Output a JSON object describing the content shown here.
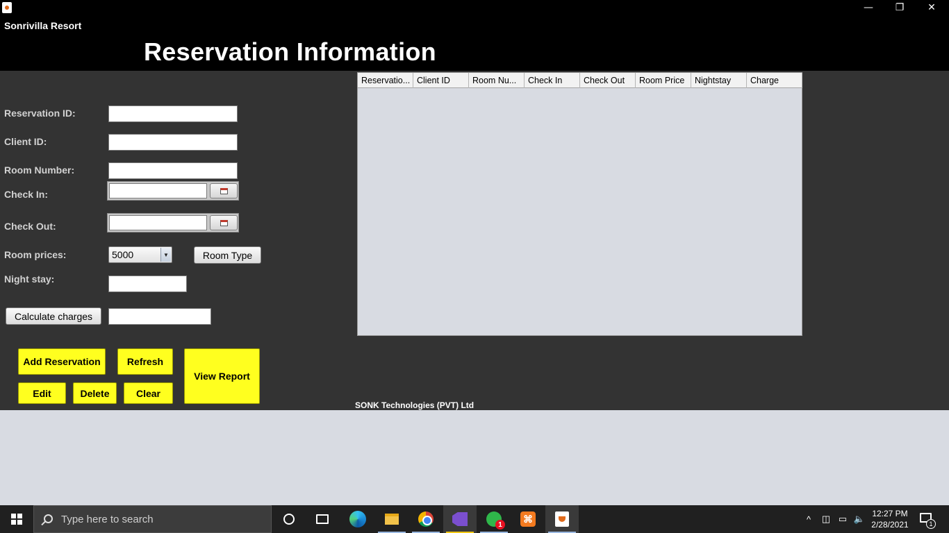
{
  "window": {
    "app_name": "Sonrivilla Resort",
    "title": "Reservation Information",
    "minimize_glyph": "—",
    "maximize_glyph": "❐",
    "close_glyph": "✕"
  },
  "form": {
    "reservation_id_label": "Reservation ID:",
    "client_id_label": "Client ID:",
    "room_number_label": "Room Number:",
    "check_in_label": "Check In:",
    "check_out_label": "Check Out:",
    "room_prices_label": "Room prices:",
    "night_stay_label": "Night stay:",
    "room_price_selected": "5000",
    "reservation_id_value": "",
    "client_id_value": "",
    "room_number_value": "",
    "check_in_value": "",
    "check_out_value": "",
    "night_stay_value": "",
    "charge_value": ""
  },
  "buttons": {
    "room_type": "Room Type",
    "calculate_charges": "Calculate charges",
    "add_reservation": "Add Reservation",
    "refresh": "Refresh",
    "view_report": "View Report",
    "edit": "Edit",
    "delete": "Delete",
    "clear": "Clear"
  },
  "table": {
    "columns": [
      "Reservatio...",
      "Client ID",
      "Room Nu...",
      "Check In",
      "Check Out",
      "Room Price",
      "Nightstay",
      "Charge"
    ],
    "rows": []
  },
  "footer": {
    "company": "SONK Technologies (PVT) Ltd"
  },
  "taskbar": {
    "search_placeholder": "Type here to search",
    "whatsapp_badge": "1",
    "tray_chevron": "^",
    "clock_time": "12:27 PM",
    "clock_date": "2/28/2021",
    "notification_count": "1",
    "colors": {
      "taskbar_bg": "#202020",
      "accent_yellow": "#ffff1f"
    }
  }
}
